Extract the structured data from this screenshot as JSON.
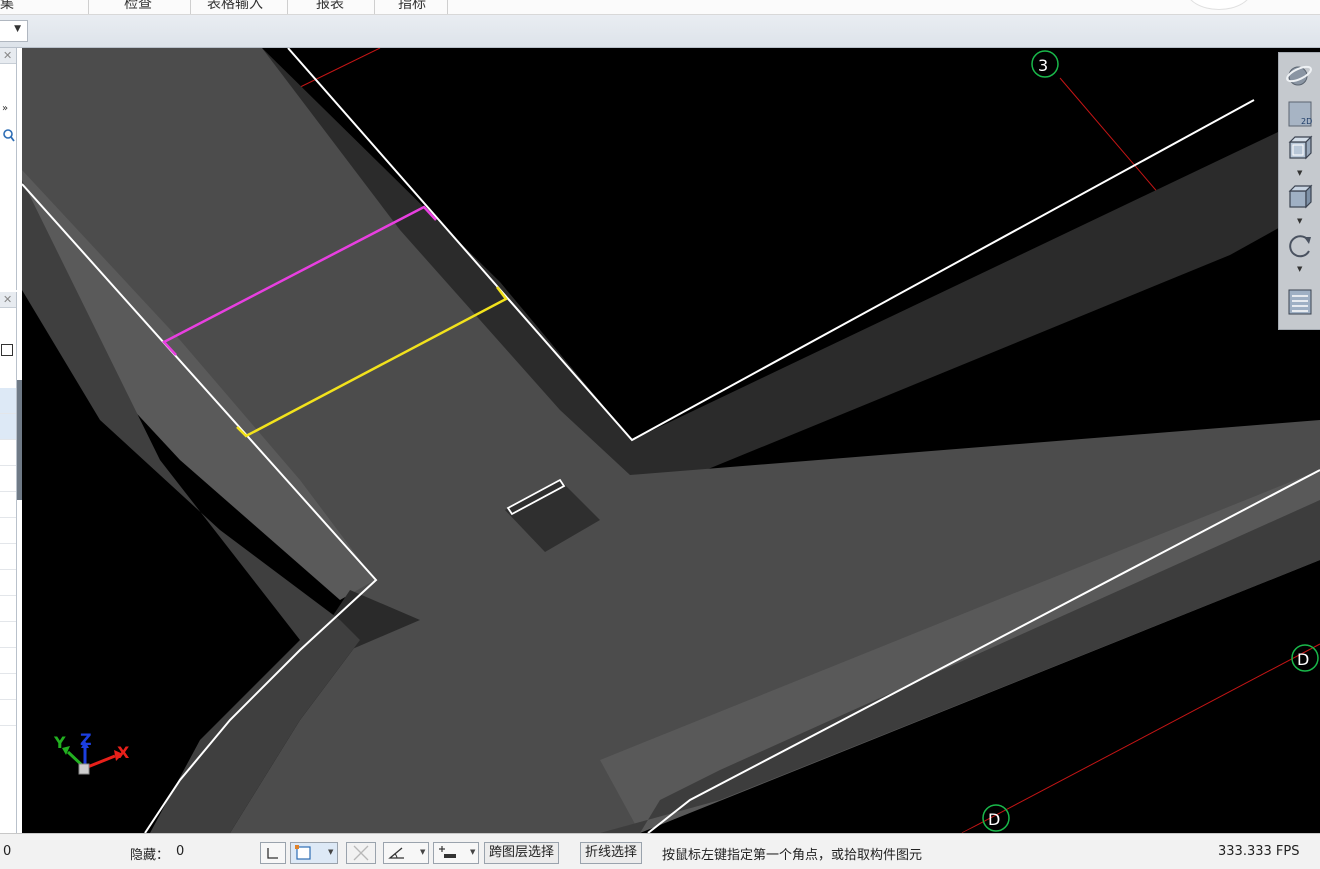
{
  "ribbon": {
    "tabs": [
      "集",
      "检查",
      "表格输入",
      "报表",
      "指标"
    ]
  },
  "viewport": {
    "axes": {
      "x": "X",
      "y": "Y",
      "z": "Z"
    },
    "grid_labels": [
      "3",
      "D",
      "D"
    ],
    "colors": {
      "background": "#000000",
      "slab": "#4a4a4a",
      "outline": "#ffffff",
      "selection_a": "#e83fe0",
      "selection_b": "#f2e21c",
      "grid_axis": "#c41515",
      "grid_marker": "#19b84a"
    }
  },
  "viewbar": {
    "icons": [
      "dynamic-observe-icon",
      "2d-view-icon",
      "3d-view-icon",
      "box-view-icon",
      "rotate-icon",
      "layer-list-icon"
    ],
    "view_2d_label": "2D"
  },
  "status": {
    "left_value": "0",
    "hidden_label": "隐藏：",
    "hidden_value": "0",
    "cross_layer_select": "跨图层选择",
    "polyline_select": "折线选择",
    "prompt": "按鼠标左键指定第一个角点，或拾取构件图元",
    "fps": "333.333 FPS"
  }
}
